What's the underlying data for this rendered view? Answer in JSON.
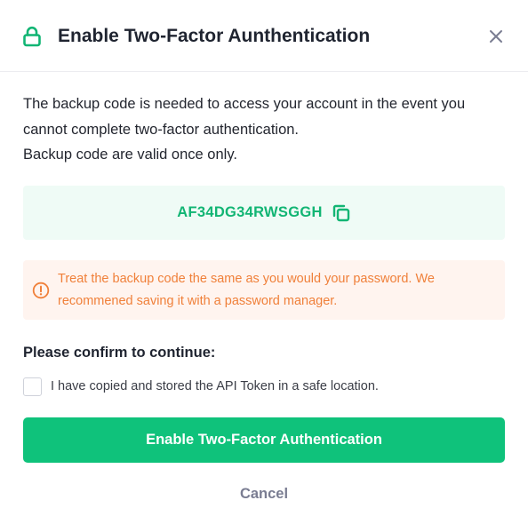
{
  "modal": {
    "title": "Enable Two-Factor Aunthentication",
    "icons": {
      "title_icon": "lock-icon",
      "close_icon": "close-icon",
      "copy_icon": "copy-icon",
      "warning_icon": "info-circle-icon"
    }
  },
  "body": {
    "description_line_1": "The backup code is needed to access your account in the event you cannot complete two-factor authentication.",
    "description_line_2": "Backup code are valid once only."
  },
  "backup_code": {
    "value": "AF34DG34RWSGGH"
  },
  "warning": {
    "text": "Treat the backup code the same as you would your password. We recommened saving it with a password manager."
  },
  "confirm": {
    "heading": "Please confirm to continue:",
    "checkbox_label": "I have copied and stored the API Token in a safe location.",
    "checked": false
  },
  "actions": {
    "primary_label": "Enable Two-Factor Authentication",
    "cancel_label": "Cancel"
  },
  "colors": {
    "accent": "#0fc27b",
    "code_text": "#12b574",
    "code_bg": "#effbf6",
    "warning_text": "#f0803a",
    "warning_bg": "#fff4ef",
    "cancel_text": "#7a7d92"
  }
}
